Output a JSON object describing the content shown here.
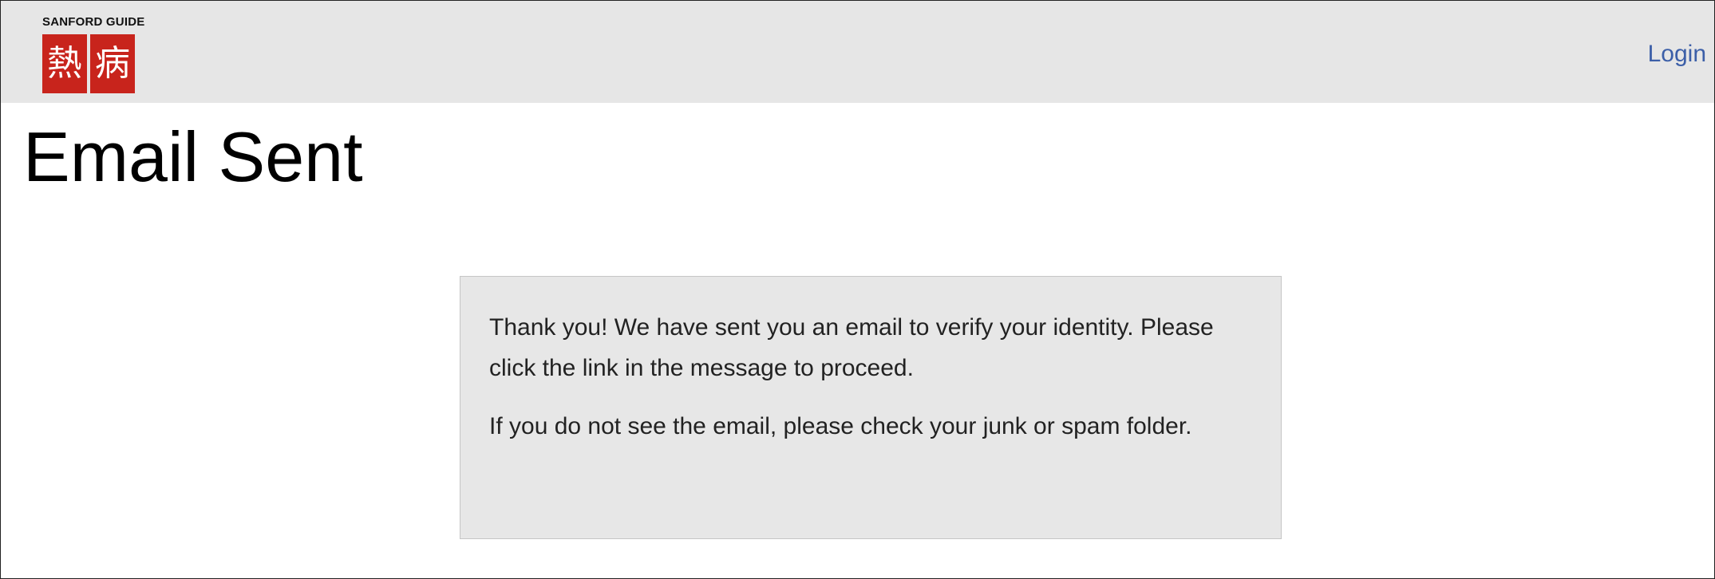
{
  "header": {
    "logo": {
      "brand_text": "SANFORD GUIDE",
      "glyph_left": "熱",
      "glyph_right": "病"
    },
    "login_label": "Login"
  },
  "main": {
    "title": "Email Sent",
    "message": {
      "paragraph_1": "Thank you! We have sent you an email to verify your identity. Please click the link in the message to proceed.",
      "paragraph_2": "If you do not see the email, please check your junk or spam folder."
    }
  },
  "colors": {
    "header_bg": "#e6e6e6",
    "logo_red": "#c8241c",
    "link_blue": "#3c5fa8",
    "box_bg": "#e7e7e7"
  }
}
